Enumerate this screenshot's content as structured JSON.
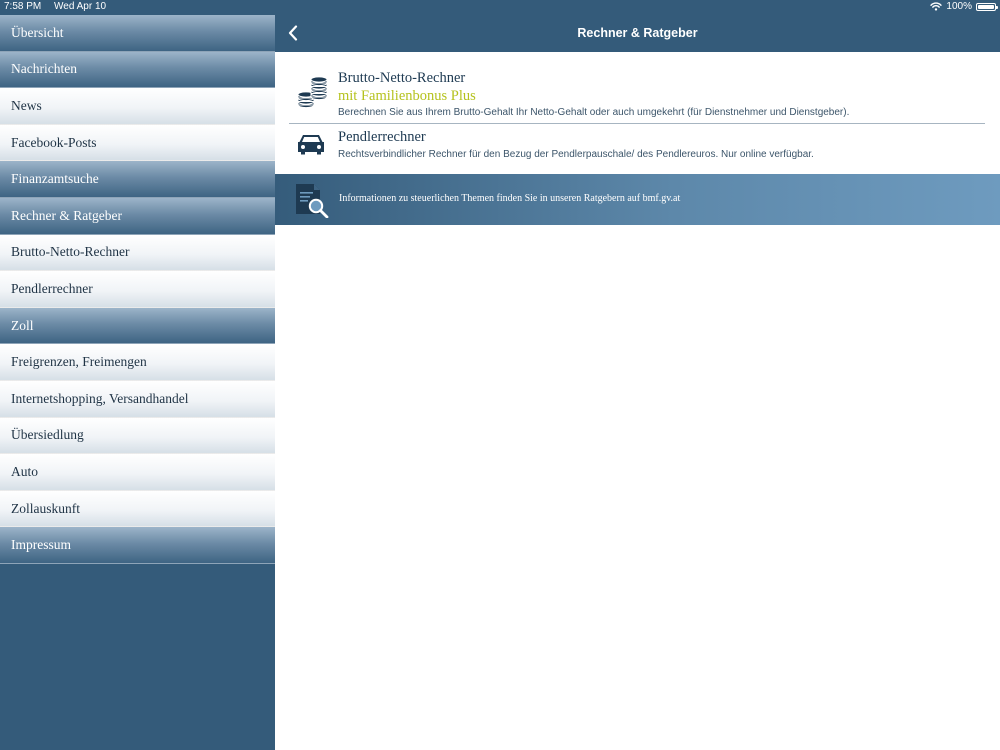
{
  "status": {
    "time": "7:58 PM",
    "date": "Wed Apr 10",
    "battery": "100%",
    "battery_level": 1.0
  },
  "sidebar": {
    "items": [
      {
        "label": "Übersicht",
        "kind": "section"
      },
      {
        "label": "Nachrichten",
        "kind": "section"
      },
      {
        "label": "News",
        "kind": "link"
      },
      {
        "label": "Facebook-Posts",
        "kind": "link"
      },
      {
        "label": "Finanzamtsuche",
        "kind": "section"
      },
      {
        "label": "Rechner & Ratgeber",
        "kind": "section"
      },
      {
        "label": "Brutto-Netto-Rechner",
        "kind": "link"
      },
      {
        "label": "Pendlerrechner",
        "kind": "link"
      },
      {
        "label": "Zoll",
        "kind": "section"
      },
      {
        "label": "Freigrenzen, Freimengen",
        "kind": "link"
      },
      {
        "label": "Internetshopping, Versandhandel",
        "kind": "link"
      },
      {
        "label": "Übersiedlung",
        "kind": "link"
      },
      {
        "label": "Auto",
        "kind": "link"
      },
      {
        "label": "Zollauskunft",
        "kind": "link"
      },
      {
        "label": "Impressum",
        "kind": "section"
      }
    ]
  },
  "header": {
    "title": "Rechner & Ratgeber",
    "back_icon": "chevron-left-icon"
  },
  "calculators": [
    {
      "title": "Brutto-Netto-Rechner",
      "subtitle": "mit Familienbonus Plus",
      "description": "Berechnen Sie aus Ihrem Brutto-Gehalt Ihr Netto-Gehalt oder auch umgekehrt (für Dienstnehmer und Dienstgeber).",
      "icon": "coins-icon"
    },
    {
      "title": "Pendlerrechner",
      "description": "Rechtsverbindlicher Rechner für den Bezug der Pendlerpauschale/ des Pendlereuros. Nur online verfügbar.",
      "icon": "car-icon"
    }
  ],
  "info_banner": {
    "text": "Informationen zu steuerlichen Themen finden Sie in unseren Ratgebern auf bmf.gv.at",
    "icon": "document-search-icon"
  },
  "colors": {
    "primary": "#345b7a",
    "accent_subtitle": "#b5c21d",
    "text_dark": "#1e3a52",
    "banner_light": "#6e9bbf"
  }
}
